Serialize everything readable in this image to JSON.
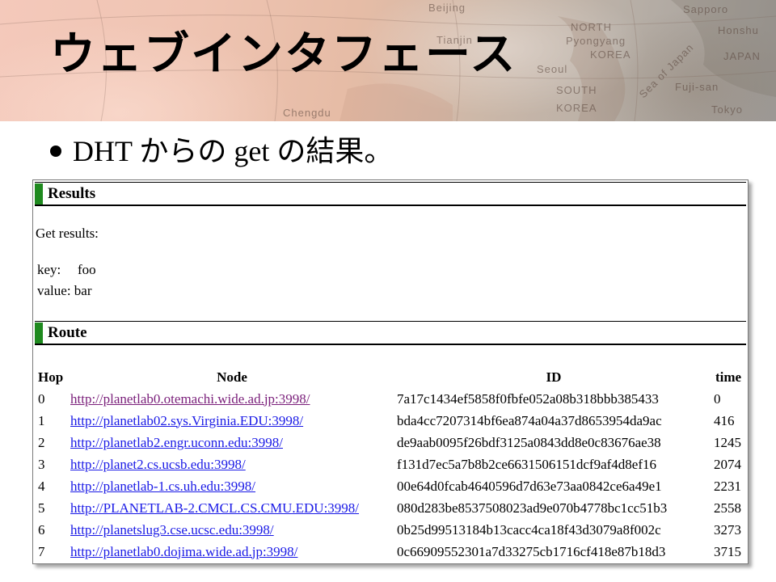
{
  "slide": {
    "title": "ウェブインタフェース",
    "bullet": "DHT からの get の結果。"
  },
  "banner": {
    "map_labels": [
      "Beijing",
      "NORTH",
      "Pyongyang",
      "KOREA",
      "Seoul",
      "SOUTH",
      "KOREA",
      "Tianjin",
      "JAPAN",
      "Honshu",
      "Tokyo",
      "Sapporo",
      "Sea of Japan",
      "Fuji-san",
      "Chengdu"
    ]
  },
  "results": {
    "heading": "Results",
    "get_results_label": "Get results:",
    "key_label": "key:",
    "key_value": "foo",
    "value_label": "value:",
    "value_value": "bar"
  },
  "route": {
    "heading": "Route",
    "columns": [
      "Hop",
      "Node",
      "ID",
      "time"
    ],
    "rows": [
      {
        "hop": "0",
        "node": "http://planetlab0.otemachi.wide.ad.jp:3998/",
        "id": "7a17c1434ef5858f0fbfe052a08b318bbb385433",
        "time": "0",
        "visited": true
      },
      {
        "hop": "1",
        "node": "http://planetlab02.sys.Virginia.EDU:3998/",
        "id": "bda4cc7207314bf6ea874a04a37d8653954da9ac",
        "time": "416",
        "visited": false
      },
      {
        "hop": "2",
        "node": "http://planetlab2.engr.uconn.edu:3998/",
        "id": "de9aab0095f26bdf3125a0843dd8e0c83676ae38",
        "time": "1245",
        "visited": false
      },
      {
        "hop": "3",
        "node": "http://planet2.cs.ucsb.edu:3998/",
        "id": "f131d7ec5a7b8b2ce6631506151dcf9af4d8ef16",
        "time": "2074",
        "visited": false
      },
      {
        "hop": "4",
        "node": "http://planetlab-1.cs.uh.edu:3998/",
        "id": "00e64d0fcab4640596d7d63e73aa0842ce6a49e1",
        "time": "2231",
        "visited": false
      },
      {
        "hop": "5",
        "node": "http://PLANETLAB-2.CMCL.CS.CMU.EDU:3998/",
        "id": "080d283be8537508023ad9e070b4778bc1cc51b3",
        "time": "2558",
        "visited": false
      },
      {
        "hop": "6",
        "node": "http://planetslug3.cse.ucsc.edu:3998/",
        "id": "0b25d99513184b13cacc4ca18f43d3079a8f002c",
        "time": "3273",
        "visited": false
      },
      {
        "hop": "7",
        "node": "http://planetlab0.dojima.wide.ad.jp:3998/",
        "id": "0c66909552301a7d33275cb1716cf418e87b18d3",
        "time": "3715",
        "visited": false
      }
    ]
  },
  "colors": {
    "link": "#1a1ae6",
    "visited_link": "#7a1f7a",
    "section_marker": "#1f8a1f"
  }
}
